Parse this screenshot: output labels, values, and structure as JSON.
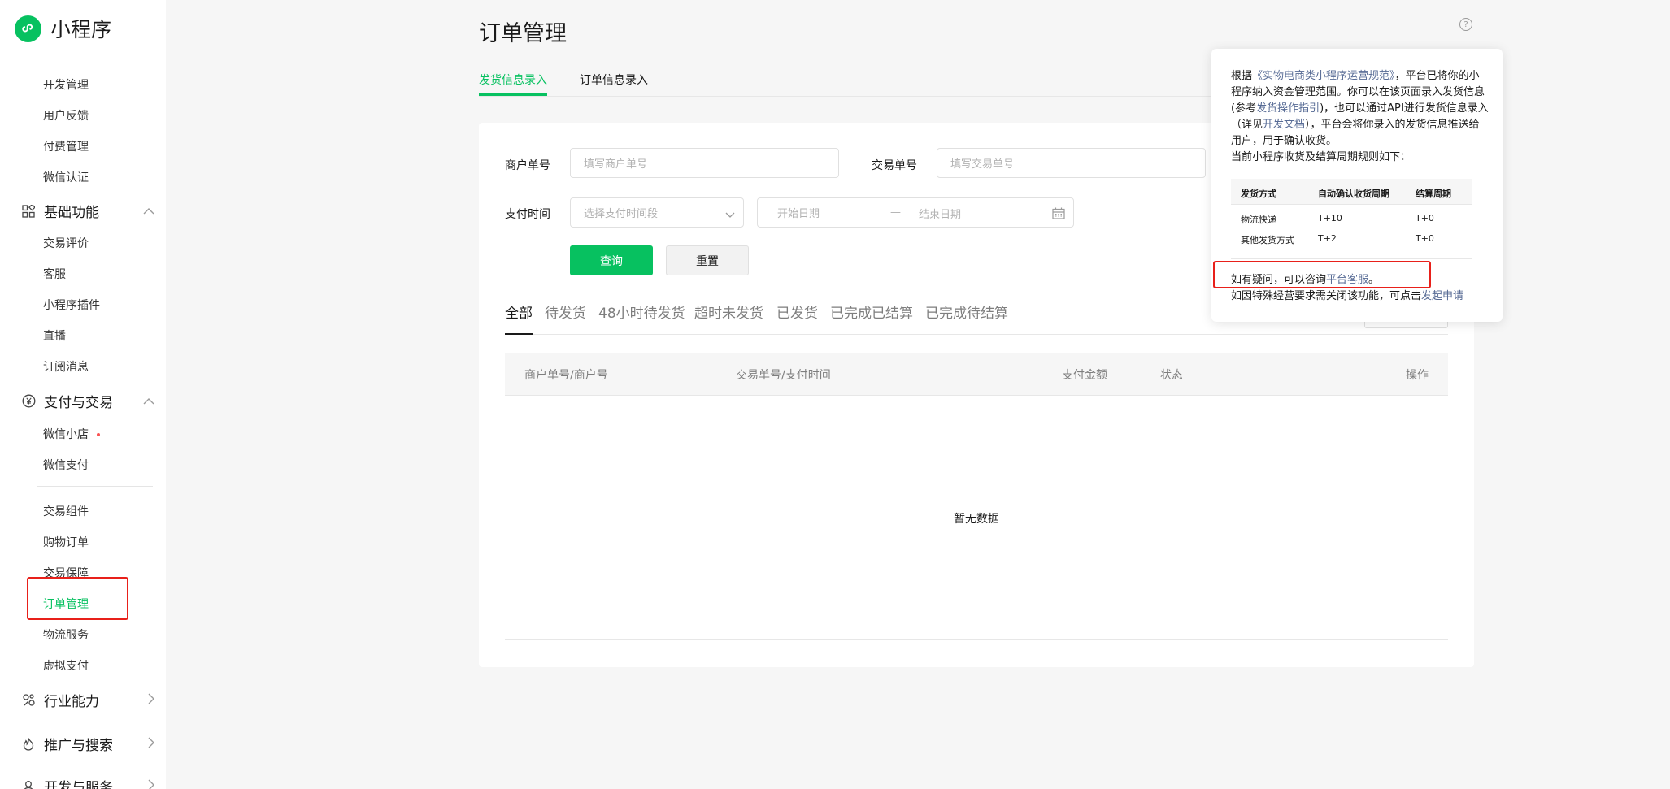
{
  "app": {
    "title": "小程序",
    "brand_color": "#07c160"
  },
  "sidebar": {
    "items": [
      {
        "label": "开发管理",
        "type": "sub"
      },
      {
        "label": "用户反馈",
        "type": "sub"
      },
      {
        "label": "付费管理",
        "type": "sub"
      },
      {
        "label": "微信认证",
        "type": "sub"
      },
      {
        "label": "基础功能",
        "type": "group",
        "icon": "grid-icon",
        "expanded": true
      },
      {
        "label": "交易评价",
        "type": "sub"
      },
      {
        "label": "客服",
        "type": "sub"
      },
      {
        "label": "小程序插件",
        "type": "sub"
      },
      {
        "label": "直播",
        "type": "sub"
      },
      {
        "label": "订阅消息",
        "type": "sub"
      },
      {
        "label": "支付与交易",
        "type": "group",
        "icon": "yen-icon",
        "expanded": true
      },
      {
        "label": "微信小店",
        "type": "sub",
        "badge": "red-dot"
      },
      {
        "label": "微信支付",
        "type": "sub"
      },
      {
        "label": "交易组件",
        "type": "sub"
      },
      {
        "label": "购物订单",
        "type": "sub"
      },
      {
        "label": "交易保障",
        "type": "sub"
      },
      {
        "label": "订单管理",
        "type": "sub",
        "active": true
      },
      {
        "label": "物流服务",
        "type": "sub"
      },
      {
        "label": "虚拟支付",
        "type": "sub"
      },
      {
        "label": "行业能力",
        "type": "group",
        "icon": "industry-icon",
        "expanded": false
      },
      {
        "label": "推广与搜索",
        "type": "group",
        "icon": "flame-icon",
        "expanded": false
      },
      {
        "label": "开发与服务",
        "type": "group",
        "icon": "user-icon",
        "expanded": false
      }
    ]
  },
  "page": {
    "title": "订单管理",
    "tabs": [
      {
        "label": "发货信息录入",
        "active": true
      },
      {
        "label": "订单信息录入",
        "active": false
      }
    ]
  },
  "filters": {
    "merchant_no_label": "商户单号",
    "merchant_no_placeholder": "填写商户单号",
    "trade_no_label": "交易单号",
    "trade_no_placeholder": "填写交易单号",
    "pay_time_label": "支付时间",
    "pay_time_select_placeholder": "选择支付时间段",
    "start_date_placeholder": "开始日期",
    "end_date_placeholder": "结束日期",
    "date_separator": "—",
    "query_button": "查询",
    "reset_button": "重置"
  },
  "status_tabs": [
    {
      "label": "全部",
      "active": true
    },
    {
      "label": "待发货",
      "active": false
    },
    {
      "label": "48小时待发货",
      "active": false
    },
    {
      "label": "超时未发货",
      "active": false
    },
    {
      "label": "已发货",
      "active": false
    },
    {
      "label": "已完成已结算",
      "active": false
    },
    {
      "label": "已完成待结算",
      "active": false
    }
  ],
  "table": {
    "columns": [
      "商户单号/商户号",
      "交易单号/支付时间",
      "支付金额",
      "状态",
      "操作"
    ],
    "empty_text": "暂无数据"
  },
  "popover": {
    "intro_1": "根据",
    "link_rules": "《实物电商类小程序运营规范》",
    "intro_2": "，平台已将你的小程序纳入资金管理范围。你可以在该页面录入发货信息(参考",
    "link_guide": "发货操作指引",
    "intro_3": ")，也可以通过API进行发货信息录入（详见",
    "link_docs": "开发文档",
    "intro_4": "），平台会将你录入的发货信息推送给用户，用于确认收货。",
    "rules_heading": "当前小程序收货及结算周期规则如下：",
    "table_headers": [
      "发货方式",
      "自动确认收货周期",
      "结算周期"
    ],
    "table_rows": [
      [
        "物流快递",
        "T+10",
        "T+0"
      ],
      [
        "其他发货方式",
        "T+2",
        "T+0"
      ]
    ],
    "help_prefix": "如有疑问，可以咨询",
    "help_link": "平台客服",
    "help_suffix": "。",
    "close_prefix": "如因特殊经营要求需关闭该功能，可点击",
    "close_link": "发起申请"
  }
}
